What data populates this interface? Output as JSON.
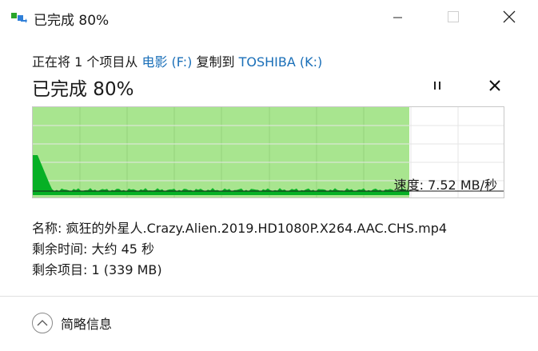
{
  "window": {
    "title": "已完成 80%",
    "icons": {
      "app": "copy-files-icon",
      "minimize": "minimize-icon",
      "maximize": "maximize-icon",
      "close": "close-icon"
    }
  },
  "operation": {
    "prefix": "正在将 1 个项目从 ",
    "source": "电影 (F:)",
    "middle": " 复制到 ",
    "destination": "TOSHIBA (K:)"
  },
  "status": {
    "text": "已完成 80%",
    "percent": 80,
    "pause_icon": "pause-icon",
    "cancel_icon": "cancel-icon"
  },
  "graph": {
    "speed_label": "速度: 7.52 MB/秒",
    "fill_color": "#a8e58f",
    "line_color": "#06b025"
  },
  "info": {
    "name_label": "名称: ",
    "name_value": "疯狂的外星人.Crazy.Alien.2019.HD1080P.X264.AAC.CHS.mp4",
    "time_label": "剩余时间: ",
    "time_value": "大约 45 秒",
    "items_label": "剩余项目: ",
    "items_value": "1 (339 MB)"
  },
  "footer": {
    "details_label": "简略信息",
    "details_icon": "chevron-up-icon"
  }
}
